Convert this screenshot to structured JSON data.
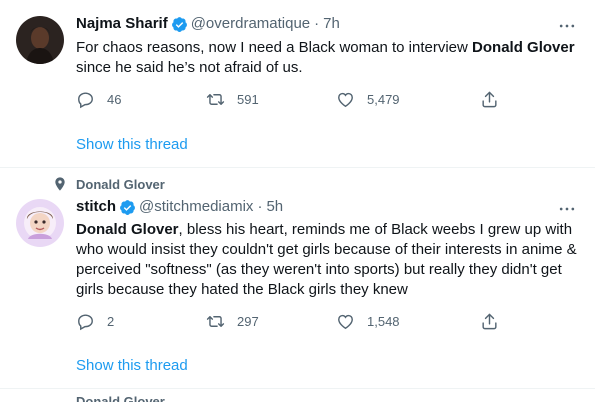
{
  "tweets": [
    {
      "name": "Najma Sharif",
      "handle": "@overdramatique",
      "time": "7h",
      "text_before": "For chaos reasons, now I need a Black woman to interview ",
      "text_bold": "Donald Glover",
      "text_after": " since he said he’s not afraid of us.",
      "replies": "46",
      "retweets": "591",
      "likes": "5,479",
      "show_thread": "Show this thread"
    },
    {
      "context": "Donald Glover",
      "name": "stitch",
      "handle": "@stitchmediamix",
      "time": "5h",
      "text_bold": "Donald Glover",
      "text_after": ", bless his heart, reminds me of Black weebs I grew up with who would insist they couldn't get girls because of their interests in anime & perceived \"softness\" (as they weren't into sports) but really they didn't get girls because they hated the Black girls they knew",
      "replies": "2",
      "retweets": "297",
      "likes": "1,548",
      "show_thread": "Show this thread"
    }
  ],
  "next_context": "Donald Glover",
  "icons": {
    "reply": "reply-icon",
    "retweet": "retweet-icon",
    "like": "heart-icon",
    "share": "share-icon",
    "more": "more-icon",
    "verified": "verified-badge-icon",
    "context": "topic-pin-icon"
  },
  "colors": {
    "accent": "#1d9bf0",
    "secondary_text": "#536471",
    "primary_text": "#0f1419",
    "divider": "#eff3f4"
  }
}
